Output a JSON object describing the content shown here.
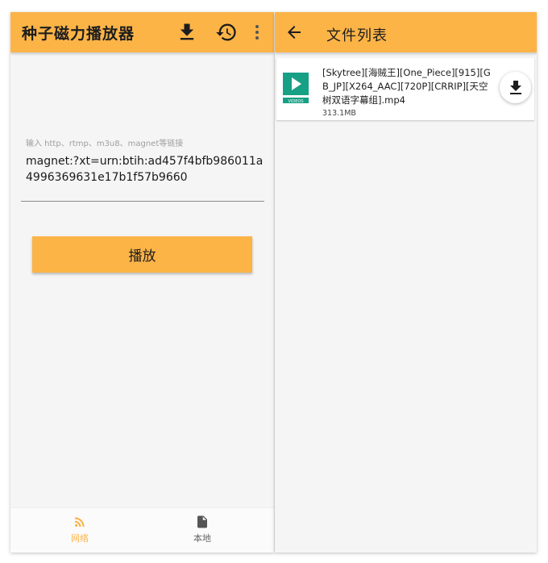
{
  "left_screen": {
    "appbar": {
      "title": "种子磁力播放器",
      "icons": [
        "download-icon",
        "history-icon",
        "more-vert-icon"
      ]
    },
    "input": {
      "hint": "输入 http、rtmp、m3u8、magnet等链接",
      "value": "magnet:?xt=urn:btih:ad457f4bfb986011a4996369631e17b1f57b9660"
    },
    "play_button": "播放",
    "bottom_nav": [
      {
        "label": "网络",
        "icon": "rss-icon",
        "active": true
      },
      {
        "label": "本地",
        "icon": "file-icon",
        "active": false
      }
    ]
  },
  "right_screen": {
    "appbar": {
      "title": "文件列表",
      "icons": [
        "back-arrow-icon"
      ]
    },
    "files": [
      {
        "name": "[Skytree][海贼王][One_Piece][915][GB_JP][X264_AAC][720P][CRRIP][天空树双语字幕组].mp4",
        "size": "313.1MB",
        "thumb_label": "VIDEOS",
        "icon": "video-file-icon",
        "action_icon": "download-icon"
      }
    ]
  },
  "colors": {
    "accent": "#fcb447",
    "thumb_green": "#16a085"
  }
}
